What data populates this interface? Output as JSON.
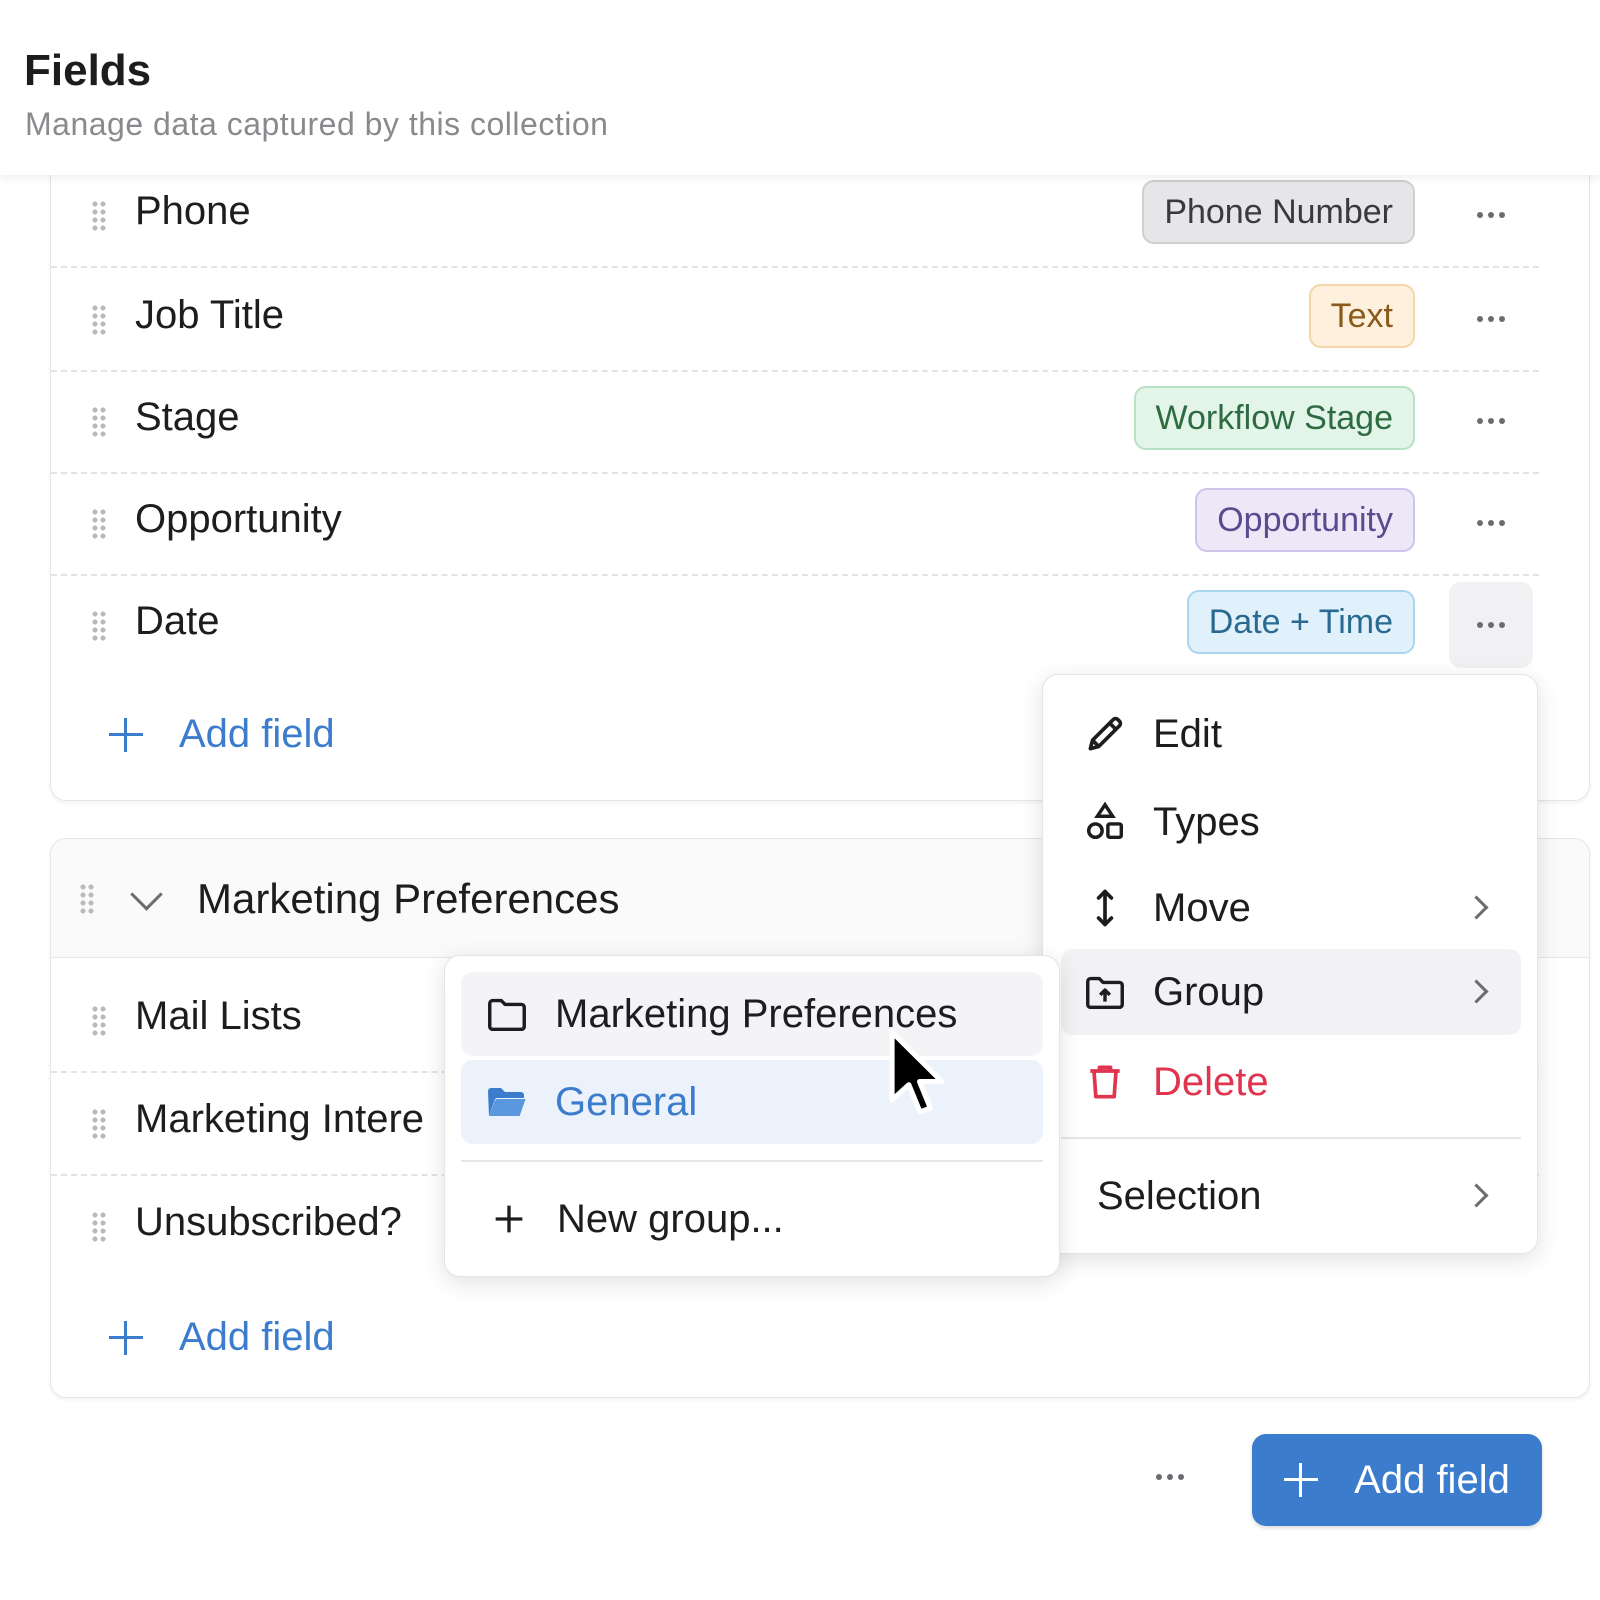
{
  "header": {
    "title": "Fields",
    "subtitle": "Manage data captured by this collection"
  },
  "contact_fields": [
    {
      "label": "Phone",
      "type": "Phone Number"
    },
    {
      "label": "Job Title",
      "type": "Text"
    },
    {
      "label": "Stage",
      "type": "Workflow Stage"
    },
    {
      "label": "Opportunity",
      "type": "Opportunity"
    },
    {
      "label": "Date",
      "type": "Date + Time"
    }
  ],
  "add_field_label": "Add field",
  "marketing_group": {
    "title": "Marketing Preferences",
    "fields": [
      {
        "label": "Mail Lists"
      },
      {
        "label": "Marketing Intere"
      },
      {
        "label": "Unsubscribed?"
      }
    ]
  },
  "context_menu": {
    "edit": "Edit",
    "types": "Types",
    "move": "Move",
    "group": "Group",
    "delete": "Delete",
    "selection": "Selection"
  },
  "group_submenu": {
    "option_marketing": "Marketing Preferences",
    "option_general": "General",
    "new_group": "New group..."
  },
  "footer": {
    "add_field_button": "Add field"
  },
  "colors": {
    "accent": "#3b7ccc",
    "danger": "#e0344f",
    "badge_phone": "#e6e6e8",
    "badge_text": "#fdf0dc",
    "badge_workflow": "#e3f5e8",
    "badge_opportunity": "#ece8f8",
    "badge_datetime": "#e1f1fb"
  }
}
